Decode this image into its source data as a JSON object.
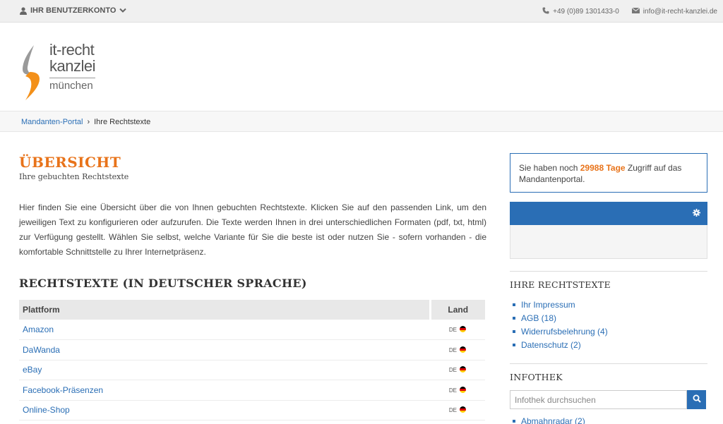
{
  "topbar": {
    "account_label": "IHR BENUTZERKONTO",
    "phone": "+49 (0)89 1301433-0",
    "email": "info@it-recht-kanzlei.de"
  },
  "logo": {
    "line1": "it-recht",
    "line2": "kanzlei",
    "line3": "münchen"
  },
  "breadcrumb": {
    "home": "Mandanten-Portal",
    "separator": "›",
    "current": "Ihre Rechtstexte"
  },
  "main": {
    "title": "ÜBERSICHT",
    "subtitle": "Ihre gebuchten Rechtstexte",
    "intro": "Hier finden Sie eine Übersicht über die von Ihnen gebuchten Rechtstexte. Klicken Sie auf den passenden Link, um den jeweiligen Text zu konfigurieren oder aufzurufen. Die Texte werden Ihnen in drei unterschiedlichen Formaten (pdf, txt, html) zur Verfügung gestellt. Wählen Sie selbst, welche Variante für Sie die beste ist oder nutzen Sie - sofern vorhanden - die komfortable Schnittstelle zu Ihrer Internetpräsenz.",
    "section_title": "RECHTSTEXTE (IN DEUTSCHER SPRACHE)",
    "table": {
      "headers": [
        "Plattform",
        "Land"
      ],
      "rows": [
        {
          "platform": "Amazon",
          "country": "DE"
        },
        {
          "platform": "DaWanda",
          "country": "DE"
        },
        {
          "platform": "eBay",
          "country": "DE"
        },
        {
          "platform": "Facebook-Präsenzen",
          "country": "DE"
        },
        {
          "platform": "Online-Shop",
          "country": "DE"
        }
      ]
    }
  },
  "sidebar": {
    "access_prefix": "Sie haben noch ",
    "access_days": "29988 Tage",
    "access_suffix": " Zugriff auf das Mandantenportal.",
    "rechtstexte_title": "IHRE RECHTSTEXTE",
    "rechtstexte_items": [
      "Ihr Impressum",
      "AGB (18)",
      "Widerrufsbelehrung (4)",
      "Datenschutz (2)"
    ],
    "infothek_title": "INFOTHEK",
    "search_placeholder": "Infothek durchsuchen",
    "infothek_items": [
      "Abmahnradar (2)"
    ]
  },
  "colors": {
    "accent_orange": "#e8731a",
    "link_blue": "#2a6eb5"
  },
  "icons": {
    "account": "user-icon",
    "chevron": "chevron-down-icon",
    "phone": "phone-icon",
    "email": "envelope-icon",
    "settings": "gear-icon",
    "search": "search-icon"
  }
}
